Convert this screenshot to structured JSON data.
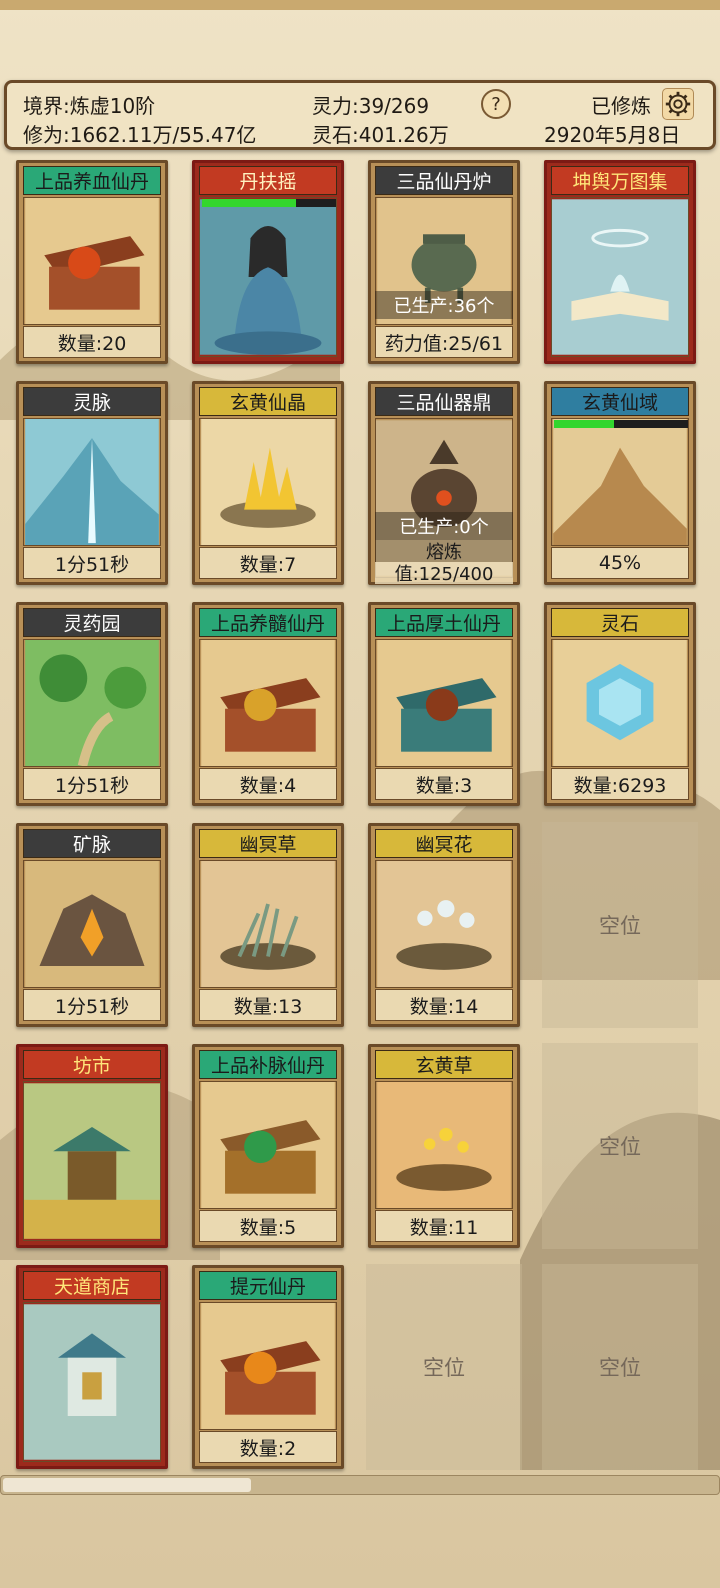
{
  "status": {
    "realm": "境界:炼虚10阶",
    "cultivation": "修为:1662.11万/55.47亿",
    "spirit_power": "灵力:39/269",
    "spirit_stone": "灵石:401.26万",
    "help_label": "?",
    "mode": "已修炼",
    "date": "2920年5月8日"
  },
  "cards": {
    "c1": {
      "title": "上品养血仙丹",
      "footer": "数量:20"
    },
    "c2": {
      "title": "丹扶摇",
      "progress": 0.7
    },
    "c3": {
      "title": "三品仙丹炉",
      "overlay": "已生产:36个",
      "footer": "药力值:25/61"
    },
    "c4": {
      "title": "坤舆万图集"
    },
    "c5": {
      "title": "灵脉",
      "footer": "1分51秒"
    },
    "c6": {
      "title": "玄黄仙晶",
      "footer": "数量:7"
    },
    "c7": {
      "title": "三品仙器鼎",
      "overlay": "已生产:0个",
      "footer1": "熔炼",
      "footer2": "值:125/400"
    },
    "c8": {
      "title": "玄黄仙域",
      "progress": 0.45,
      "footer": "45%"
    },
    "c9": {
      "title": "灵药园",
      "footer": "1分51秒"
    },
    "c10": {
      "title": "上品养髓仙丹",
      "footer": "数量:4"
    },
    "c11": {
      "title": "上品厚土仙丹",
      "footer": "数量:3"
    },
    "c12": {
      "title": "灵石",
      "footer": "数量:6293"
    },
    "c13": {
      "title": "矿脉",
      "footer": "1分51秒"
    },
    "c14": {
      "title": "幽冥草",
      "footer": "数量:13"
    },
    "c15": {
      "title": "幽冥花",
      "footer": "数量:14"
    },
    "c16": {
      "title": "坊市"
    },
    "c17": {
      "title": "上品补脉仙丹",
      "footer": "数量:5"
    },
    "c18": {
      "title": "玄黄草",
      "footer": "数量:11"
    },
    "c19": {
      "title": "天道商店"
    },
    "c20": {
      "title": "提元仙丹",
      "footer": "数量:2"
    }
  },
  "empty_label": "空位",
  "colors": {
    "title_green": "#2aa877",
    "title_red": "#c23a22",
    "title_gray": "#3c3c3c",
    "title_yellow": "#d7b83a",
    "title_blue": "#2f7ea0",
    "progress_fill": "#33d62e"
  },
  "icons": {
    "help": "question-icon",
    "settings": "gear-icon"
  },
  "scroll_position": 0.35
}
